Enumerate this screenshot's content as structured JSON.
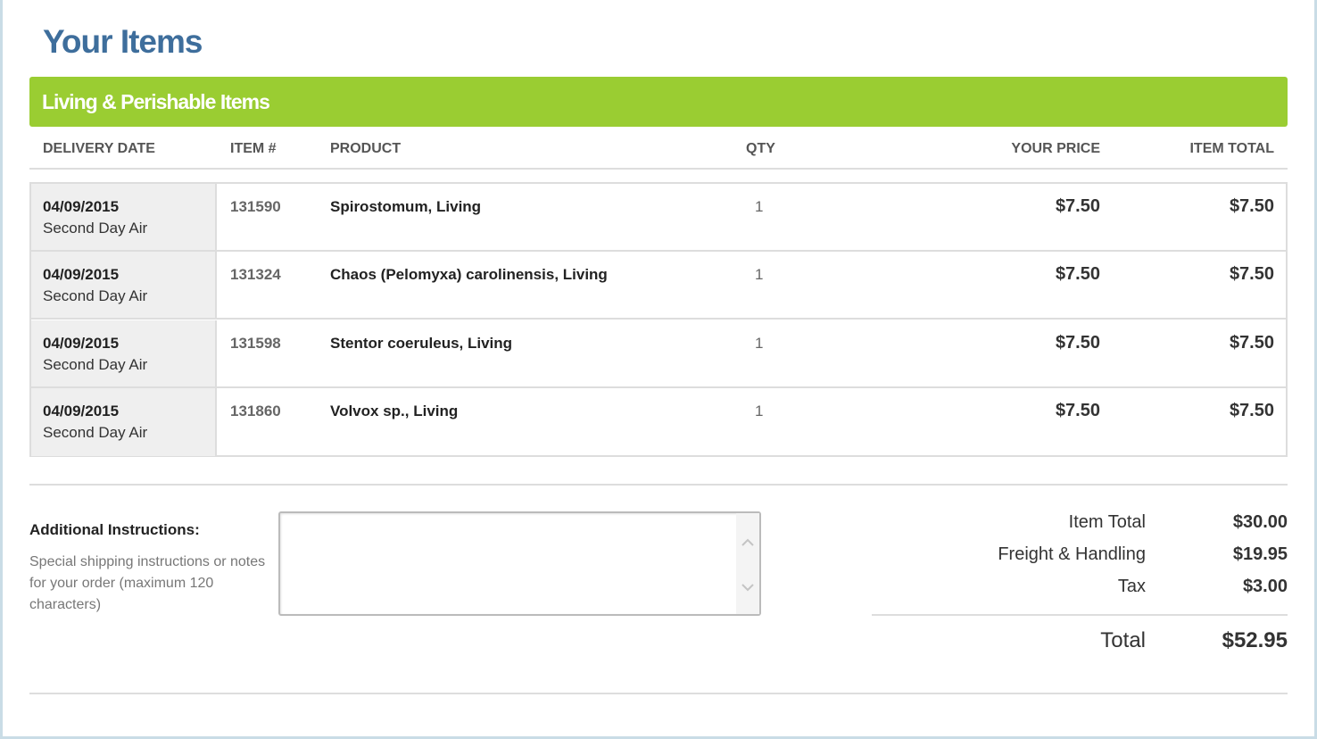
{
  "page": {
    "title": "Your Items"
  },
  "section": {
    "title": "Living & Perishable Items",
    "accent_color": "#9acd32"
  },
  "columns": {
    "delivery_date": "DELIVERY DATE",
    "item_no": "ITEM #",
    "product": "PRODUCT",
    "qty": "QTY",
    "your_price": "YOUR PRICE",
    "item_total": "ITEM TOTAL"
  },
  "rows": [
    {
      "date": "04/09/2015",
      "shipping": "Second Day Air",
      "item_no": "131590",
      "product": "Spirostomum, Living",
      "qty": "1",
      "price": "$7.50",
      "total": "$7.50"
    },
    {
      "date": "04/09/2015",
      "shipping": "Second Day Air",
      "item_no": "131324",
      "product": "Chaos (Pelomyxa) carolinensis, Living",
      "qty": "1",
      "price": "$7.50",
      "total": "$7.50"
    },
    {
      "date": "04/09/2015",
      "shipping": "Second Day Air",
      "item_no": "131598",
      "product": "Stentor coeruleus, Living",
      "qty": "1",
      "price": "$7.50",
      "total": "$7.50"
    },
    {
      "date": "04/09/2015",
      "shipping": "Second Day Air",
      "item_no": "131860",
      "product": "Volvox sp., Living",
      "qty": "1",
      "price": "$7.50",
      "total": "$7.50"
    }
  ],
  "instructions": {
    "label": "Additional Instructions:",
    "help": "Special shipping instructions or notes for your order (maximum 120 characters)",
    "value": ""
  },
  "summary": {
    "item_total_label": "Item Total",
    "item_total_value": "$30.00",
    "freight_label": "Freight & Handling",
    "freight_value": "$19.95",
    "tax_label": "Tax",
    "tax_value": "$3.00",
    "total_label": "Total",
    "total_value": "$52.95"
  }
}
